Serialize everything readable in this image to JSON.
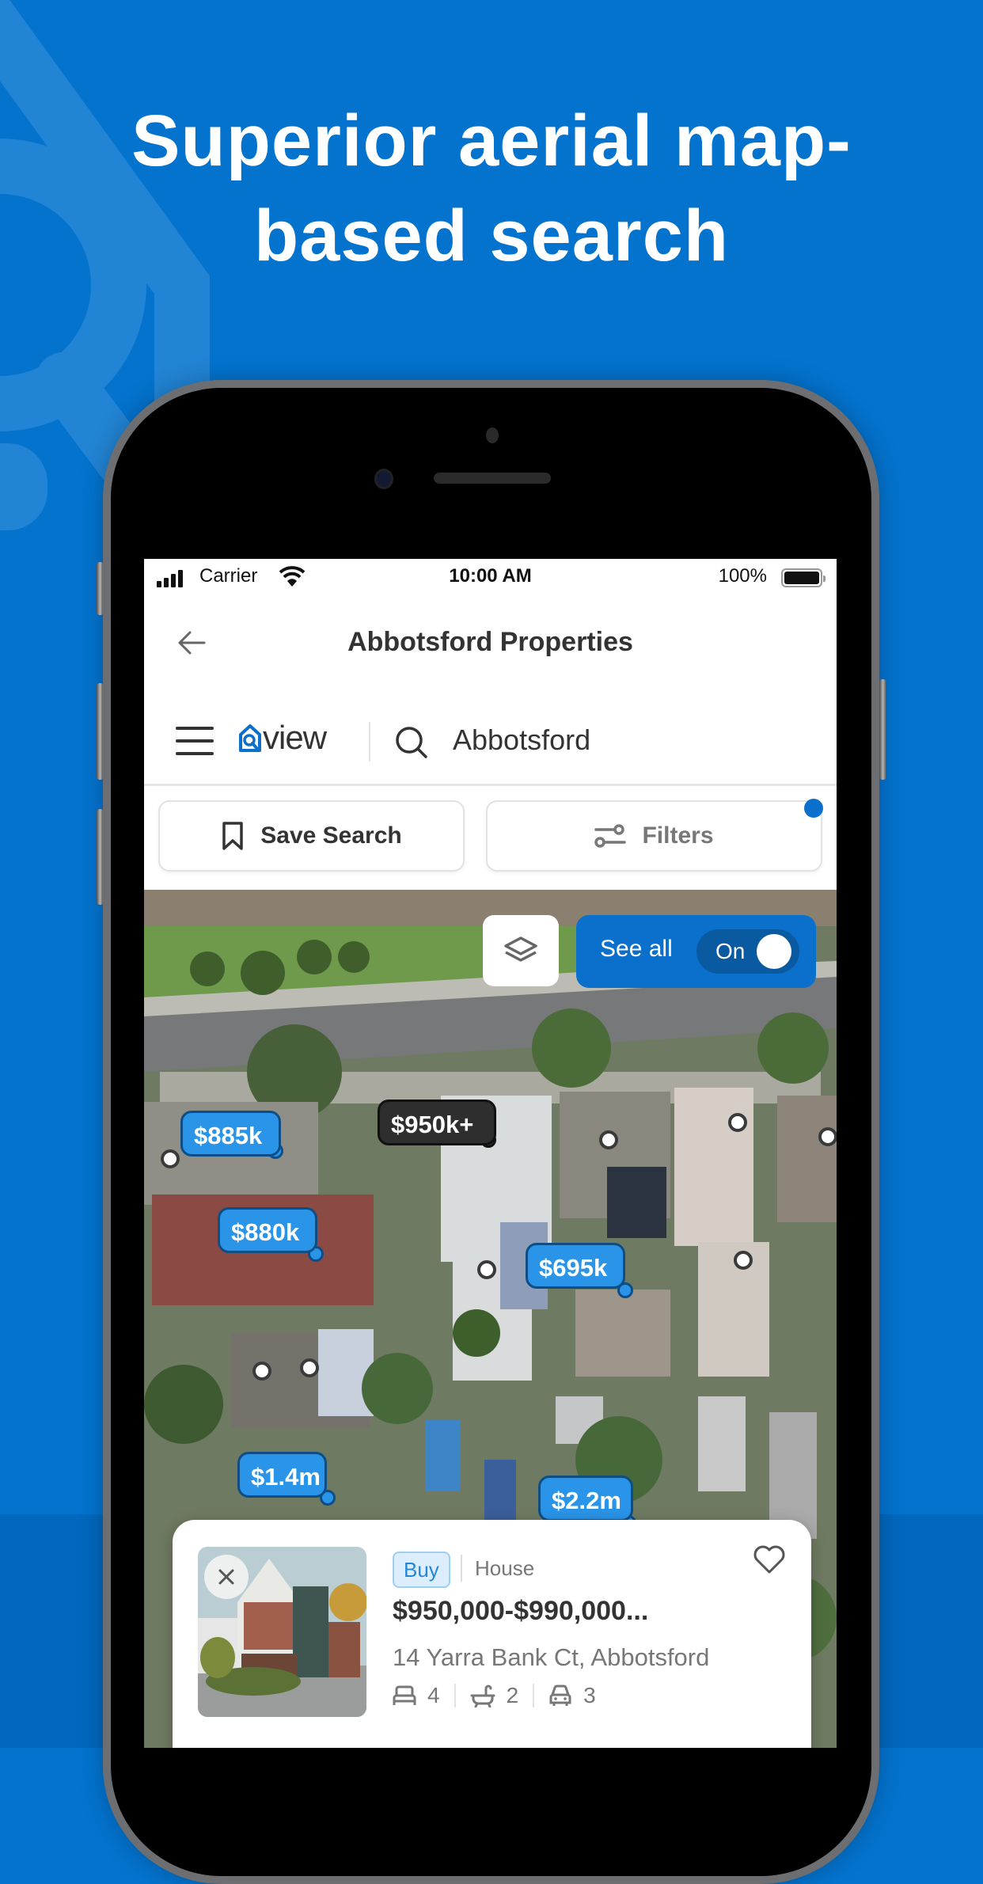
{
  "headline": {
    "line1": "Superior aerial map-",
    "line2": "based search"
  },
  "colors": {
    "background": "#0373CE",
    "accent": "#0B6FCC",
    "pin": "#2A94E8",
    "pin_dark": "#2E2E2E"
  },
  "status_bar": {
    "carrier": "Carrier",
    "time": "10:00 AM",
    "battery": "100%"
  },
  "nav": {
    "back_icon": "arrow-left-icon",
    "title": "Abbotsford Properties"
  },
  "search_bar": {
    "menu_icon": "hamburger-icon",
    "logo_text": "view",
    "search_icon": "magnifier-icon",
    "value": "Abbotsford"
  },
  "actions": {
    "save_search": "Save Search",
    "save_icon": "bookmark-icon",
    "filters": "Filters",
    "filters_icon": "sliders-icon",
    "filters_active": true
  },
  "map": {
    "layers_icon": "layers-icon",
    "see_all_label": "See all",
    "see_all_toggle": "On",
    "price_pins": [
      {
        "label": "$885k",
        "style": "blue"
      },
      {
        "label": "$950k+",
        "style": "dark"
      },
      {
        "label": "$880k",
        "style": "blue"
      },
      {
        "label": "$695k",
        "style": "blue"
      },
      {
        "label": "$1.4m",
        "style": "blue"
      },
      {
        "label": "$2.2m",
        "style": "blue"
      }
    ]
  },
  "listing_card": {
    "badge": "Buy",
    "property_type": "House",
    "price": "$950,000-$990,000...",
    "address": "14 Yarra Bank Ct, Abbotsford",
    "beds": "4",
    "baths": "2",
    "cars": "3",
    "close_icon": "close-icon",
    "favorite_icon": "heart-icon"
  }
}
